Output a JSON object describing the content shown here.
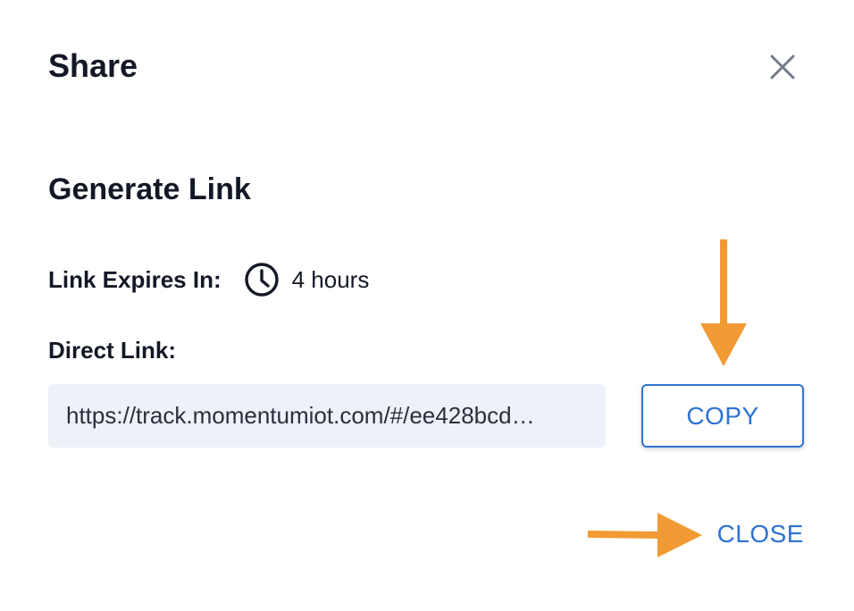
{
  "dialog": {
    "title": "Share",
    "close_icon": "close-icon"
  },
  "generate_link": {
    "heading": "Generate Link",
    "expires_label": "Link Expires In:",
    "expires_icon": "clock-icon",
    "expires_value": "4 hours",
    "direct_link_label": "Direct Link:",
    "direct_link_value": "https://track.momentumiot.com/#/ee428bcd…",
    "copy_label": "COPY"
  },
  "footer": {
    "close_label": "CLOSE"
  },
  "colors": {
    "accent": "#2f73d1",
    "field_background": "#edf1f8",
    "annotation_arrow": "#f29a33",
    "text": "#141826"
  }
}
